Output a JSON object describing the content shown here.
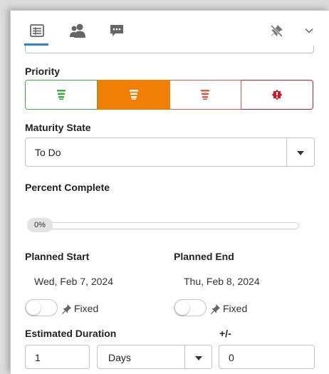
{
  "tabs": [
    {
      "name": "details",
      "icon": "list-details-icon",
      "active": true
    },
    {
      "name": "people",
      "icon": "people-icon",
      "active": false
    },
    {
      "name": "comments",
      "icon": "comment-icon",
      "active": false
    }
  ],
  "header_right_icons": [
    "pin-off-icon",
    "chevron-down-icon"
  ],
  "priority": {
    "label": "Priority",
    "options": [
      {
        "name": "low",
        "icon": "priority-low-icon",
        "color": "#3fae49",
        "selected": false
      },
      {
        "name": "normal",
        "icon": "priority-normal-icon",
        "color": "#f07f06",
        "selected": true
      },
      {
        "name": "high",
        "icon": "priority-high-icon",
        "color": "#e05a4e",
        "selected": false
      },
      {
        "name": "critical",
        "icon": "priority-critical-icon",
        "color": "#c0202e",
        "selected": false
      }
    ]
  },
  "maturity": {
    "label": "Maturity State",
    "value": "To Do"
  },
  "percent": {
    "label": "Percent Complete",
    "value_text": "0%",
    "value": 0
  },
  "planned_start": {
    "label": "Planned Start",
    "value": "Wed, Feb 7, 2024",
    "fixed_label": "Fixed",
    "fixed": false
  },
  "planned_end": {
    "label": "Planned End",
    "value": "Thu, Feb 8, 2024",
    "fixed_label": "Fixed",
    "fixed": false
  },
  "estimated_duration": {
    "label": "Estimated Duration",
    "value": "1",
    "unit": "Days"
  },
  "plus_minus": {
    "label": "+/-",
    "value": "0"
  },
  "colors": {
    "accent": "#2f7fd1",
    "normal_priority": "#f07f06",
    "progress_fill": "#7cb342"
  }
}
